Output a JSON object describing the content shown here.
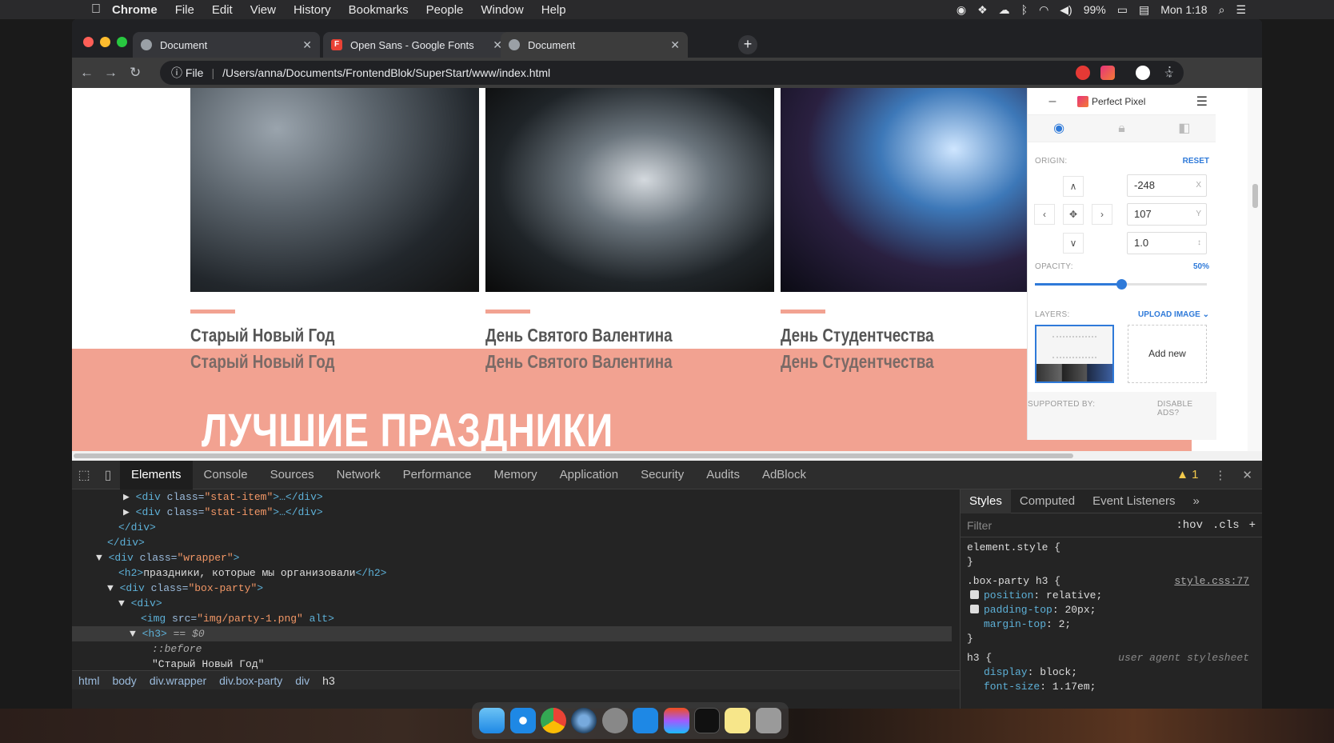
{
  "menubar": {
    "app": "Chrome",
    "items": [
      "File",
      "Edit",
      "View",
      "History",
      "Bookmarks",
      "People",
      "Window",
      "Help"
    ],
    "battery": "99%",
    "clock": "Mon 1:18"
  },
  "tabs": [
    {
      "title": "Document"
    },
    {
      "title": "Open Sans - Google Fonts"
    },
    {
      "title": "Document"
    }
  ],
  "address": {
    "scheme": "File",
    "url": "/Users/anna/Documents/FrontendBlok/SuperStart/www/index.html"
  },
  "page": {
    "cards": [
      {
        "title": "Старый Новый Год",
        "overlay": "Старый Новый Год"
      },
      {
        "title": "День Святого Валентина",
        "overlay": "День Святого Валентина"
      },
      {
        "title": "День Студентчества",
        "overlay": "День Студентчества"
      }
    ],
    "section_title": "ЛУЧШИЕ ПРАЗДНИКИ"
  },
  "perfect_pixel": {
    "name": "Perfect Pixel",
    "origin_label": "ORIGIN:",
    "reset": "RESET",
    "x": "-248",
    "x_unit": "X",
    "y": "107",
    "y_unit": "Y",
    "scale": "1.0",
    "scale_unit": "↕",
    "opacity_label": "OPACITY:",
    "opacity": 0.5,
    "opacity_text": "50%",
    "layers_label": "LAYERS:",
    "upload": "UPLOAD IMAGE",
    "add_new": "Add new",
    "supported_by": "SUPPORTED BY:",
    "disable_ads": "DISABLE ADS?"
  },
  "devtools": {
    "tabs": [
      "Elements",
      "Console",
      "Sources",
      "Network",
      "Performance",
      "Memory",
      "Application",
      "Security",
      "Audits",
      "AdBlock"
    ],
    "warnings": "1",
    "dom": [
      {
        "pre": "▶ ",
        "open": "<div ",
        "attr": "class=",
        "val": "\"stat-item\"",
        "close": ">…</div>"
      },
      {
        "pre": "▶ ",
        "open": "<div ",
        "attr": "class=",
        "val": "\"stat-item\"",
        "close": ">…</div>"
      },
      {
        "pre": "",
        "open": "</div>",
        "attr": "",
        "val": "",
        "close": ""
      },
      {
        "pre": "",
        "open": "</div>",
        "attr": "",
        "val": "",
        "close": ""
      },
      {
        "pre": "▼ ",
        "open": "<div ",
        "attr": "class=",
        "val": "\"wrapper\"",
        "close": ">"
      },
      {
        "pre": "",
        "open": "<h2>",
        "attr": "",
        "val": "праздники, которые мы организовали",
        "close": "</h2>"
      },
      {
        "pre": "▼ ",
        "open": "<div ",
        "attr": "class=",
        "val": "\"box-party\"",
        "close": ">"
      },
      {
        "pre": "▼ ",
        "open": "<div>",
        "attr": "",
        "val": "",
        "close": ""
      },
      {
        "pre": "",
        "open": "<img ",
        "attr": "src=",
        "val": "\"img/party-1.png\"",
        "close": " alt>"
      },
      {
        "pre": "▼ ",
        "open": "<h3>",
        "attr": "",
        "val": " == $0",
        "close": ""
      },
      {
        "pre": "",
        "open": "::before",
        "attr": "",
        "val": "",
        "close": ""
      },
      {
        "pre": "",
        "open": "\"Старый Новый Год\"",
        "attr": "",
        "val": "",
        "close": ""
      }
    ],
    "breadcrumbs": [
      "html",
      "body",
      "div.wrapper",
      "div.box-party",
      "div",
      "h3"
    ],
    "side_tabs": [
      "Styles",
      "Computed",
      "Event Listeners",
      "»"
    ],
    "filter_placeholder": "Filter",
    "hov": ":hov",
    "cls": ".cls",
    "styles": {
      "element_style": "element.style {",
      "close": "}",
      "rule_selector": ".box-party h3 {",
      "rule_source": "style.css:77",
      "props": [
        {
          "name": "position",
          "value": "relative;",
          "checked": true
        },
        {
          "name": "padding-top",
          "value": "20px;",
          "checked": true
        },
        {
          "name": "margin-top",
          "value": "2;",
          "checked": false
        }
      ],
      "ua_selector": "h3 {",
      "ua_source": "user agent stylesheet",
      "ua_props": [
        {
          "name": "display",
          "value": "block;"
        },
        {
          "name": "font-size",
          "value": "1.17em;"
        }
      ]
    }
  },
  "colors": {
    "accent": "#f2a291",
    "link": "#2f7ad9"
  }
}
